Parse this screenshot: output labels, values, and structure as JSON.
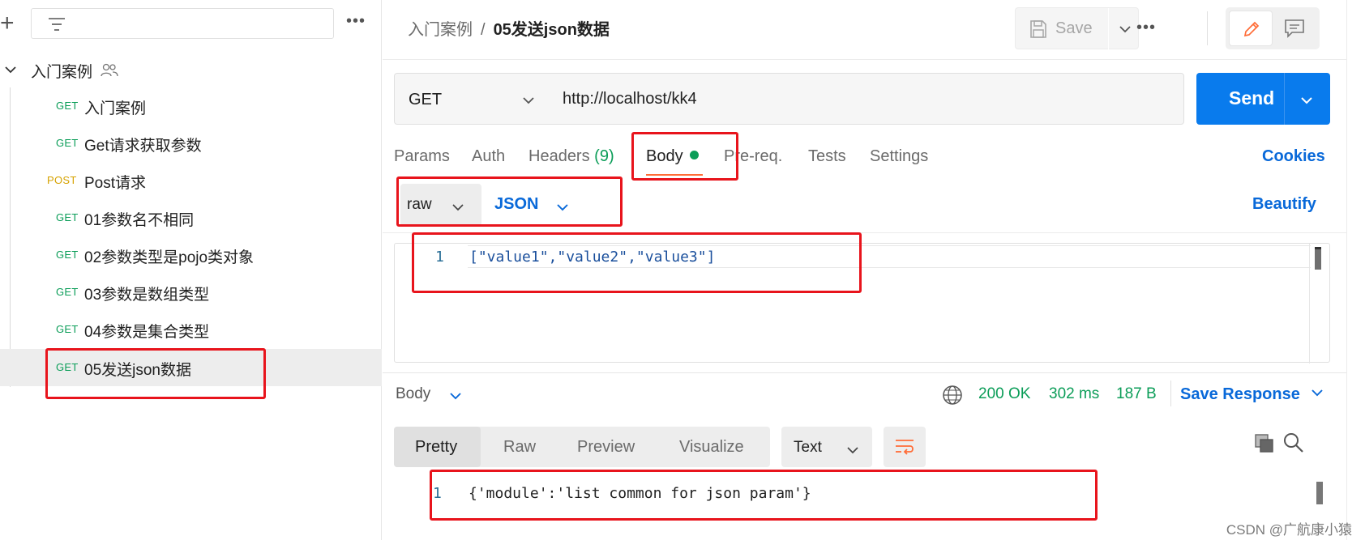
{
  "sidebar": {
    "collection": {
      "name": "入门案例"
    },
    "requests": [
      {
        "method": "GET",
        "title": "入门案例"
      },
      {
        "method": "GET",
        "title": "Get请求获取参数"
      },
      {
        "method": "POST",
        "title": "Post请求"
      },
      {
        "method": "GET",
        "title": "01参数名不相同"
      },
      {
        "method": "GET",
        "title": "02参数类型是pojo类对象"
      },
      {
        "method": "GET",
        "title": "03参数是数组类型"
      },
      {
        "method": "GET",
        "title": "04参数是集合类型"
      },
      {
        "method": "GET",
        "title": "05发送json数据"
      }
    ],
    "active_index": 7
  },
  "header": {
    "breadcrumb_parent": "入门案例",
    "breadcrumb_sep": "/",
    "breadcrumb_current": "05发送json数据",
    "save_label": "Save"
  },
  "request": {
    "method": "GET",
    "url": "http://localhost/kk4",
    "send_label": "Send",
    "tabs": {
      "params": "Params",
      "auth": "Auth",
      "headers": "Headers",
      "headers_count": "(9)",
      "body": "Body",
      "prereq": "Pre-req.",
      "tests": "Tests",
      "settings": "Settings"
    },
    "cookies_label": "Cookies",
    "body_mode": "raw",
    "body_lang": "JSON",
    "beautify_label": "Beautify",
    "editor": {
      "line": "1",
      "code": "[\"value1\",\"value2\",\"value3\"]"
    }
  },
  "response": {
    "body_label": "Body",
    "status": "200 OK",
    "time": "302 ms",
    "size": "187 B",
    "save_label": "Save Response",
    "tabs": {
      "pretty": "Pretty",
      "raw": "Raw",
      "preview": "Preview",
      "visualize": "Visualize"
    },
    "format": "Text",
    "code": {
      "line": "1",
      "code": "{'module':'list common for json param'}"
    }
  },
  "colors": {
    "send": "#097bed",
    "get": "#0b9d58",
    "post": "#d6a200",
    "link": "#0969d9",
    "annotation": "#e8141c",
    "accent": "#ff6c37"
  },
  "watermark": "CSDN @广航康小猿"
}
